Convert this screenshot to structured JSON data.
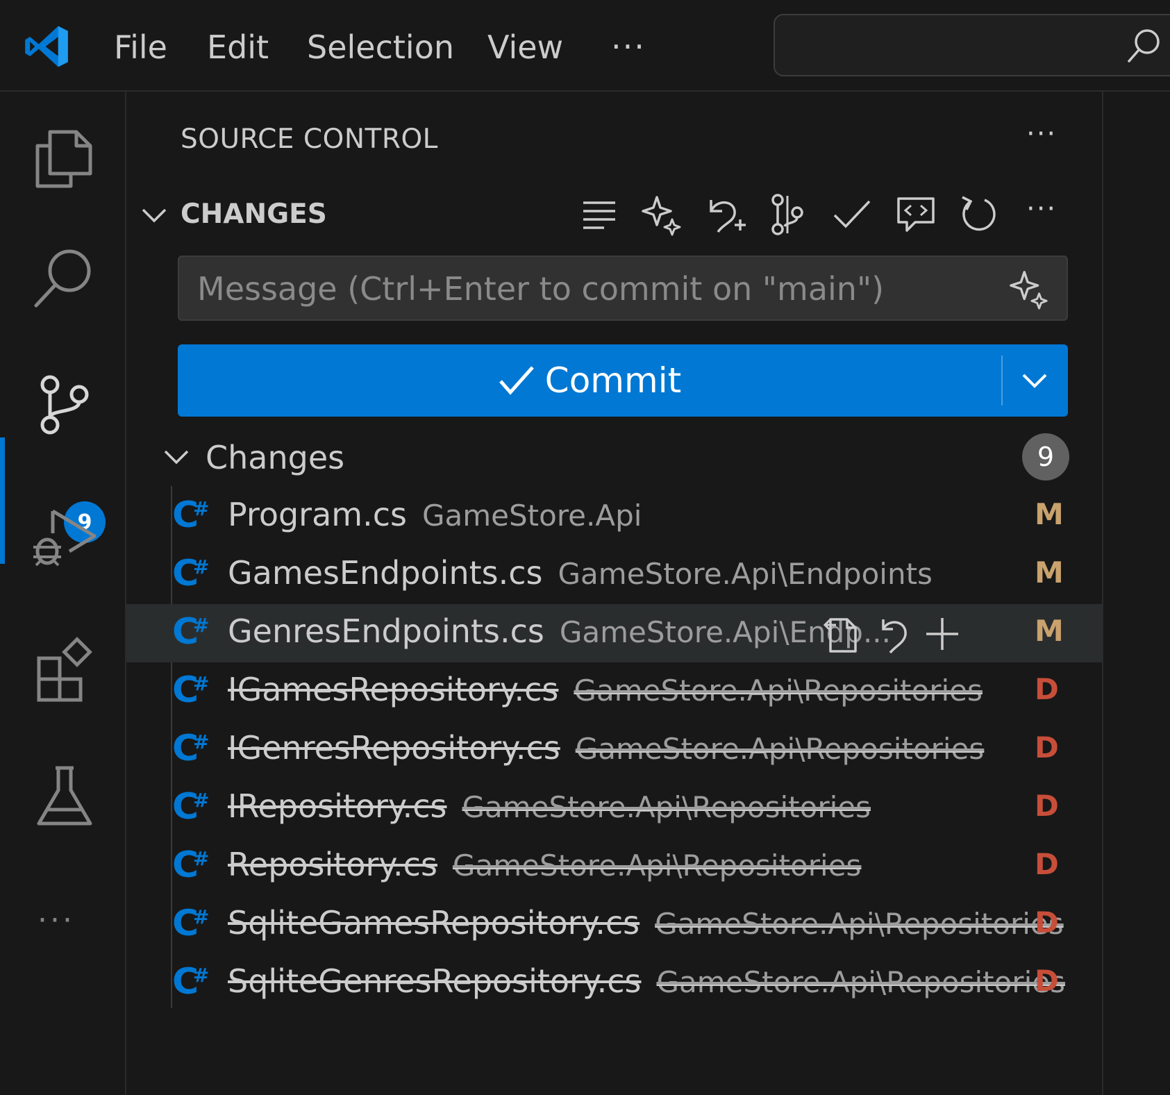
{
  "menu": {
    "file": "File",
    "edit": "Edit",
    "selection": "Selection",
    "view": "View",
    "more": "···"
  },
  "activity": {
    "scm_badge": "9",
    "more": "···"
  },
  "sidebar": {
    "title": "SOURCE CONTROL",
    "more": "···",
    "section_header": "CHANGES",
    "message_placeholder": "Message (Ctrl+Enter to commit on \"main\")",
    "commit_label": "Commit",
    "group_label": "Changes",
    "group_count": "9"
  },
  "colors": {
    "accent": "#0078d4",
    "modified": "#c9a26d",
    "deleted": "#c74e39",
    "csharp": "#0078d4"
  },
  "files": [
    {
      "name": "Program.cs",
      "path": "GameStore.Api",
      "status": "M"
    },
    {
      "name": "GamesEndpoints.cs",
      "path": "GameStore.Api\\Endpoints",
      "status": "M"
    },
    {
      "name": "GenresEndpoints.cs",
      "path": "GameStore.Api\\Endp...",
      "status": "M"
    },
    {
      "name": "IGamesRepository.cs",
      "path": "GameStore.Api\\Repositories",
      "status": "D"
    },
    {
      "name": "IGenresRepository.cs",
      "path": "GameStore.Api\\Repositories",
      "status": "D"
    },
    {
      "name": "IRepository.cs",
      "path": "GameStore.Api\\Repositories",
      "status": "D"
    },
    {
      "name": "Repository.cs",
      "path": "GameStore.Api\\Repositories",
      "status": "D"
    },
    {
      "name": "SqliteGamesRepository.cs",
      "path": "GameStore.Api\\Repositories",
      "status": "D"
    },
    {
      "name": "SqliteGenresRepository.cs",
      "path": "GameStore.Api\\Repositories",
      "status": "D"
    }
  ]
}
